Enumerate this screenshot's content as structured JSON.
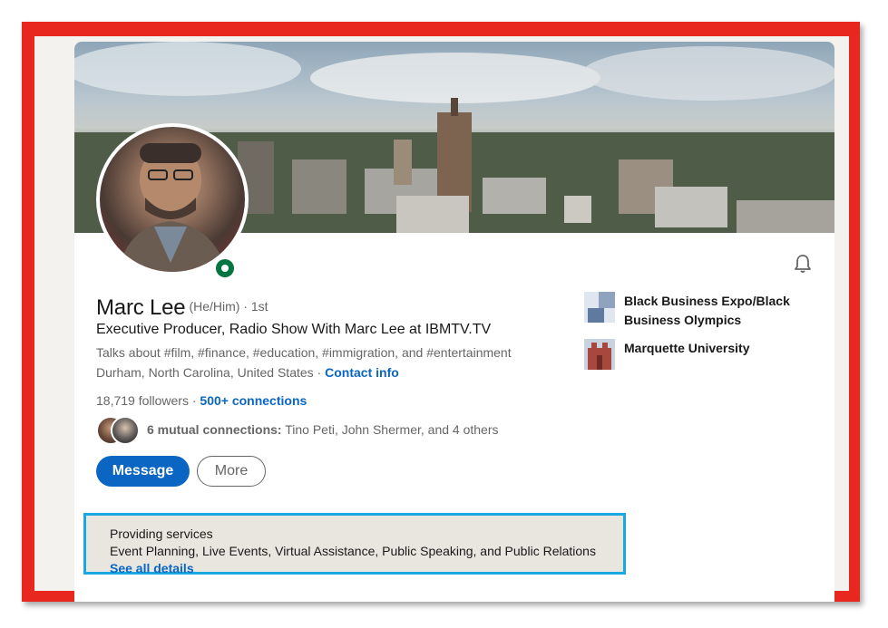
{
  "profile": {
    "name": "Marc Lee",
    "pronouns": "(He/Him) · 1st",
    "headline": "Executive Producer, Radio Show With Marc Lee at IBMTV.TV",
    "talks_about": "Talks about #film, #finance, #education, #immigration, and #entertainment",
    "location": "Durham, North Carolina, United States",
    "location_sep": " · ",
    "contact_info": "Contact info",
    "followers": "18,719 followers",
    "followers_sep": " · ",
    "connections": "500+ connections",
    "mutual_bold": "6 mutual connections:",
    "mutual_rest": " Tino Peti, John Shermer, and 4 others"
  },
  "actions": {
    "message_label": "Message",
    "more_label": "More"
  },
  "services": {
    "title": "Providing services",
    "list": "Event Planning, Live Events, Virtual Assistance, Public Speaking, and Public Relations",
    "link": "See all details"
  },
  "experience": [
    {
      "name": "Black Business Expo/Black Business Olympics",
      "logo": "black-business-expo-logo"
    },
    {
      "name": "Marquette University",
      "logo": "marquette-university-logo"
    }
  ],
  "icons": {
    "notification": "bell-icon",
    "status": "online-status-icon"
  },
  "colors": {
    "frame": "#e8271e",
    "highlight": "#1aa8e0",
    "link": "#0a66c2",
    "online": "#057642"
  }
}
